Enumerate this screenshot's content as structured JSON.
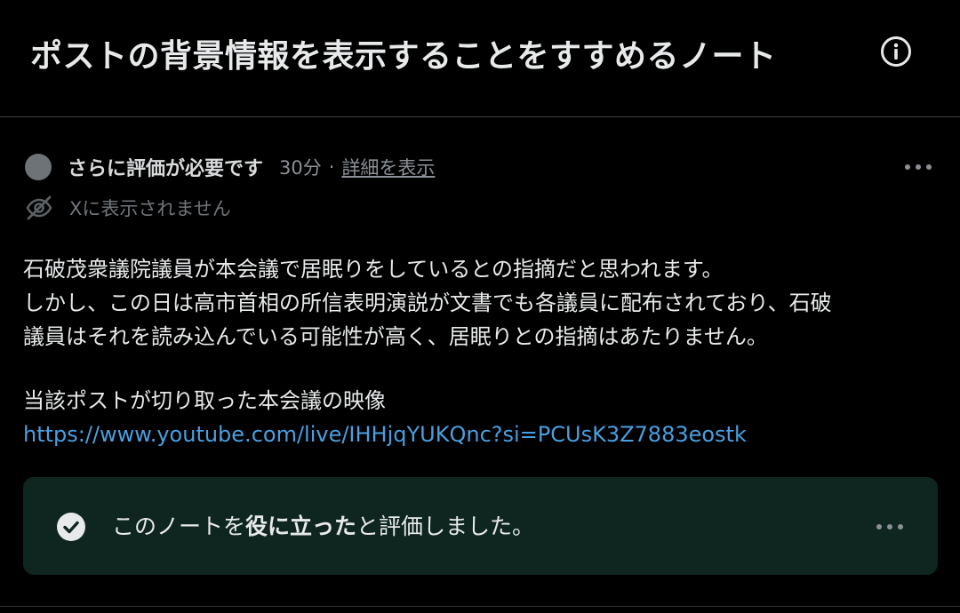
{
  "header": {
    "title": "ポストの背景情報を表示することをすすめるノート",
    "info_icon": "info-circle-icon"
  },
  "note": {
    "status": "さらに評価が必要です",
    "time": "30分",
    "separator": "·",
    "details_link": "詳細を表示",
    "more_icon": "more-horizontal-icon",
    "visibility_icon": "eye-off-icon",
    "visibility_text": "Xに表示されません",
    "body_lines": [
      "石破茂衆議院議員が本会議で居眠りをしているとの指摘だと思われます。",
      "しかし、この日は高市首相の所信表明演説が文書でも各議員に配布されており、石破",
      "議員はそれを読み込んでいる可能性が高く、居眠りとの指摘はあたりません。"
    ],
    "source_label": "当該ポストが切り取った本会議の映像",
    "source_link": "https://www.youtube.com/live/IHHjqYUKQnc?si=PCUsK3Z7883eostk"
  },
  "rating": {
    "text_before": "このノートを",
    "text_bold": "役に立った",
    "text_after": "と評価しました。",
    "check_icon": "check-circle-icon",
    "more_icon": "more-horizontal-icon"
  },
  "colors": {
    "background": "#000000",
    "text": "#e7e9ea",
    "muted": "#71767b",
    "link": "#4a9fe0",
    "rated_box": "#0e2520"
  }
}
